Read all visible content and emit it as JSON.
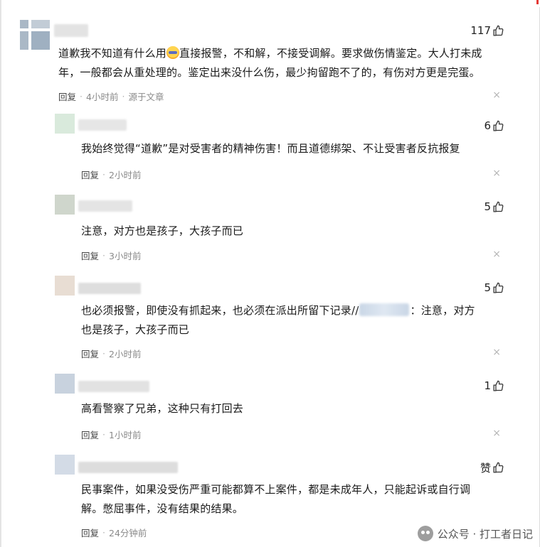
{
  "comments": [
    {
      "likes": "117",
      "content": "道歉我不知道有什么用{emoji}直接报警，不和解，不接受调解。要求做伤情鉴定。大人打未成年，一般都会从重处理的。鉴定出来没什么伤，最少拘留跑不了的，有伤对方更是完蛋。",
      "line1a": "道歉我不知道有什么用",
      "line1b": "直接报警，不和解，不接受调解。要求做伤情鉴定。大人打未成",
      "line2": "年，一般都会从重处理的。鉴定出来没什么伤，最少拘留跑不了的，有伤对方更是完蛋。",
      "reply": "回复",
      "time": "4小时前",
      "source": "源于文章"
    },
    {
      "likes": "6",
      "content": "我始终觉得“道歉”是对受害者的精神伤害！而且道德绑架、不让受害者反抗报复",
      "reply": "回复",
      "time": "2小时前"
    },
    {
      "likes": "5",
      "content": "注意，对方也是孩子，大孩子而已",
      "reply": "回复",
      "time": "3小时前"
    },
    {
      "likes": "5",
      "line1a": "也必须报警，即使没有抓起来，也必须在派出所留下记录//",
      "line1b": "：注意，对方",
      "line2": "也是孩子，大孩子而已",
      "reply": "回复",
      "time": "2小时前"
    },
    {
      "likes": "1",
      "content": "高看警察了兄弟，这种只有打回去",
      "reply": "回复",
      "time": "1小时前"
    },
    {
      "likes": "赞",
      "line1": "民事案件，如果没受伤严重可能都算不上案件，都是未成年人，只能起诉或自行调",
      "line2": "解。憋屈事件，没有结果的结果。",
      "reply": "回复",
      "time": "24分钟前"
    }
  ],
  "close_glyph": "×",
  "watermark": {
    "text": "公众号 · 打工者日记"
  },
  "colors": {
    "text": "#1a1a1a",
    "meta": "#8a8a8a",
    "accent_corner": "#e53935"
  },
  "icons": {
    "like": "thumbs-up-icon",
    "close": "close-icon",
    "emoji": "emoji-icon"
  }
}
